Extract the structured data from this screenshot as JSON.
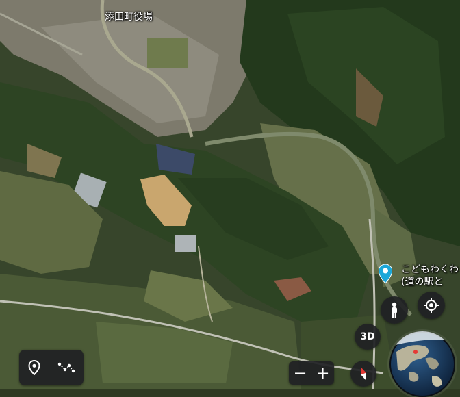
{
  "map": {
    "place_label_town_hall": "添田町役場",
    "poi_name_line1": "こどもわくわ",
    "poi_name_line2": "(道の駅と"
  },
  "controls": {
    "street_view_icon": "pegman-icon",
    "my_location_icon": "crosshair-icon",
    "btn_3d": "3D",
    "zoom_out": "−",
    "zoom_in": "+",
    "compass_icon": "compass-icon",
    "tools": [
      "pin-icon",
      "measure-path-icon"
    ]
  },
  "colors": {
    "poi_marker": "#1ba7d8",
    "control_bg": "#202124",
    "compass_north": "#e53935",
    "globe_location_dot": "#e53935"
  }
}
